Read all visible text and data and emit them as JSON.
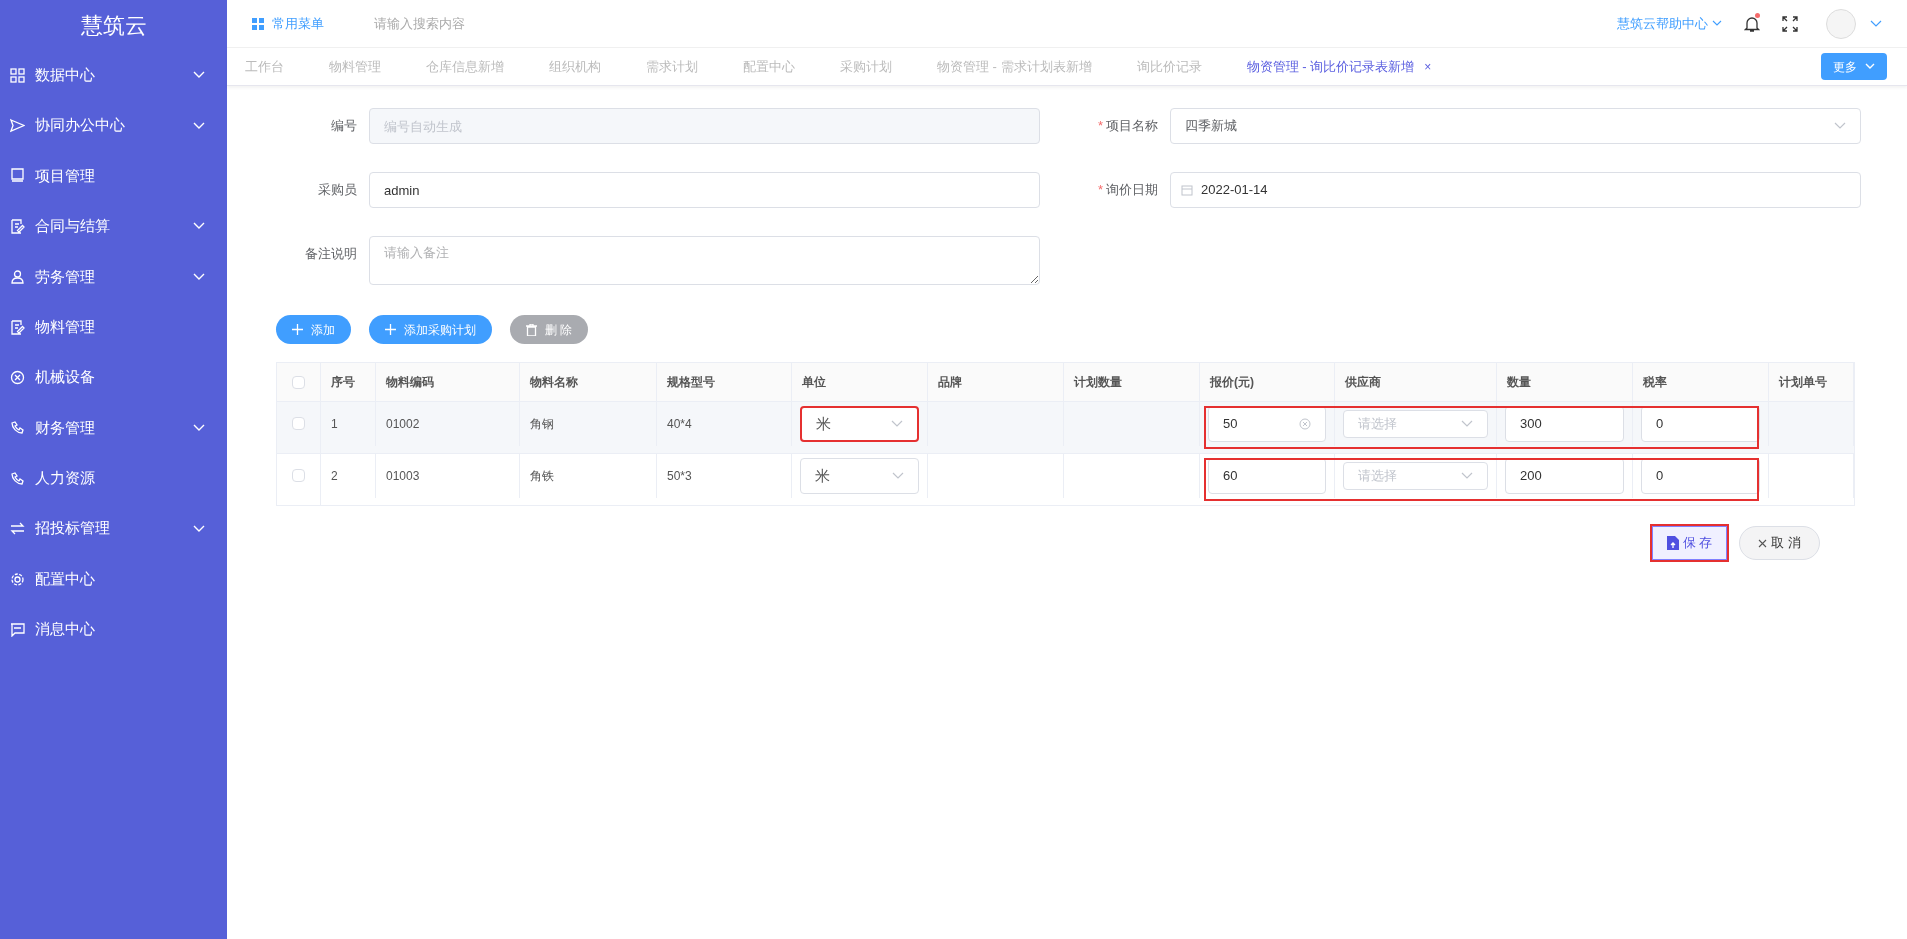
{
  "sidebar": {
    "logo": "慧筑云",
    "items": [
      {
        "label": "数据中心",
        "expandable": true
      },
      {
        "label": "协同办公中心",
        "expandable": true
      },
      {
        "label": "项目管理",
        "expandable": false
      },
      {
        "label": "合同与结算",
        "expandable": true
      },
      {
        "label": "劳务管理",
        "expandable": true
      },
      {
        "label": "物料管理",
        "expandable": false
      },
      {
        "label": "机械设备",
        "expandable": false
      },
      {
        "label": "财务管理",
        "expandable": true
      },
      {
        "label": "人力资源",
        "expandable": false
      },
      {
        "label": "招投标管理",
        "expandable": true
      },
      {
        "label": "配置中心",
        "expandable": false
      },
      {
        "label": "消息中心",
        "expandable": false
      }
    ]
  },
  "header": {
    "menu_label": "常用菜单",
    "search": {
      "placeholder": "请输入搜索内容"
    },
    "help_link": "慧筑云帮助中心",
    "notification_dot": true
  },
  "tabs": [
    {
      "label": "工作台",
      "selected": false
    },
    {
      "label": "物料管理",
      "selected": false
    },
    {
      "label": "仓库信息新增",
      "selected": false
    },
    {
      "label": "组织机构",
      "selected": false
    },
    {
      "label": "需求计划",
      "selected": false
    },
    {
      "label": "配置中心",
      "selected": false
    },
    {
      "label": "采购计划",
      "selected": false
    },
    {
      "label": "物资管理 - 需求计划表新增",
      "selected": false
    },
    {
      "label": "询比价记录",
      "selected": false
    },
    {
      "label": "物资管理 - 询比价记录表新增",
      "selected": true,
      "close": "×"
    }
  ],
  "more_button": "更多",
  "form": {
    "number": {
      "label": "编号",
      "placeholder": "编号自动生成",
      "disabled": true
    },
    "project": {
      "label": "项目名称",
      "required_mark": "*",
      "value": "四季新城"
    },
    "buyer": {
      "label": "采购员",
      "value": "admin"
    },
    "date": {
      "label": "询价日期",
      "required_mark": "*",
      "value": "2022-01-14"
    },
    "remark": {
      "label": "备注说明",
      "placeholder": "请输入备注"
    }
  },
  "actions": [
    {
      "label": "添加",
      "kind": "add"
    },
    {
      "label": "添加采购计划",
      "kind": "add"
    },
    {
      "label": "删 除",
      "kind": "delete"
    }
  ],
  "table": {
    "all_checked": false,
    "columns": [
      "序号",
      "物料编码",
      "物料名称",
      "规格型号",
      "单位",
      "品牌",
      "计划数量",
      "报价(元)",
      "供应商",
      "数量",
      "税率",
      "计划单号"
    ],
    "rows": [
      {
        "checked": false,
        "index": "1",
        "code": "01002",
        "name": "角钢",
        "spec": "40*4",
        "unit": "米",
        "unit_highlighted": true,
        "price": "50",
        "price_clearable": true,
        "supplier_placeholder": "请选择",
        "quantity": "300",
        "tax": "0",
        "quote_highlighted": true
      },
      {
        "checked": false,
        "index": "2",
        "code": "01003",
        "name": "角铁",
        "spec": "50*3",
        "unit": "米",
        "unit_highlighted": false,
        "price": "60",
        "price_clearable": false,
        "supplier_placeholder": "请选择",
        "quantity": "200",
        "tax": "0",
        "quote_highlighted": true
      }
    ]
  },
  "footer_buttons": {
    "save": {
      "label": "保 存",
      "highlighted": true
    },
    "cancel": {
      "label": "取 消"
    }
  }
}
